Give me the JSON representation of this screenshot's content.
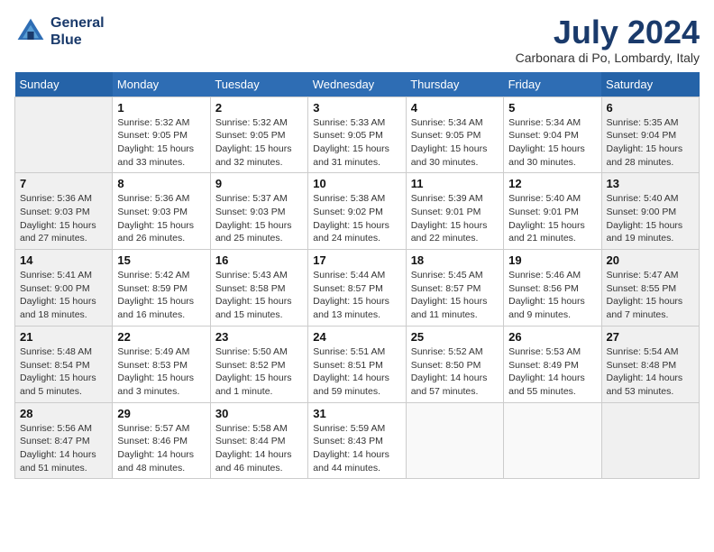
{
  "header": {
    "logo_line1": "General",
    "logo_line2": "Blue",
    "month_title": "July 2024",
    "location": "Carbonara di Po, Lombardy, Italy"
  },
  "days_of_week": [
    "Sunday",
    "Monday",
    "Tuesday",
    "Wednesday",
    "Thursday",
    "Friday",
    "Saturday"
  ],
  "weeks": [
    [
      {
        "day": "",
        "info": ""
      },
      {
        "day": "1",
        "info": "Sunrise: 5:32 AM\nSunset: 9:05 PM\nDaylight: 15 hours\nand 33 minutes."
      },
      {
        "day": "2",
        "info": "Sunrise: 5:32 AM\nSunset: 9:05 PM\nDaylight: 15 hours\nand 32 minutes."
      },
      {
        "day": "3",
        "info": "Sunrise: 5:33 AM\nSunset: 9:05 PM\nDaylight: 15 hours\nand 31 minutes."
      },
      {
        "day": "4",
        "info": "Sunrise: 5:34 AM\nSunset: 9:05 PM\nDaylight: 15 hours\nand 30 minutes."
      },
      {
        "day": "5",
        "info": "Sunrise: 5:34 AM\nSunset: 9:04 PM\nDaylight: 15 hours\nand 30 minutes."
      },
      {
        "day": "6",
        "info": "Sunrise: 5:35 AM\nSunset: 9:04 PM\nDaylight: 15 hours\nand 28 minutes."
      }
    ],
    [
      {
        "day": "7",
        "info": "Sunrise: 5:36 AM\nSunset: 9:03 PM\nDaylight: 15 hours\nand 27 minutes."
      },
      {
        "day": "8",
        "info": "Sunrise: 5:36 AM\nSunset: 9:03 PM\nDaylight: 15 hours\nand 26 minutes."
      },
      {
        "day": "9",
        "info": "Sunrise: 5:37 AM\nSunset: 9:03 PM\nDaylight: 15 hours\nand 25 minutes."
      },
      {
        "day": "10",
        "info": "Sunrise: 5:38 AM\nSunset: 9:02 PM\nDaylight: 15 hours\nand 24 minutes."
      },
      {
        "day": "11",
        "info": "Sunrise: 5:39 AM\nSunset: 9:01 PM\nDaylight: 15 hours\nand 22 minutes."
      },
      {
        "day": "12",
        "info": "Sunrise: 5:40 AM\nSunset: 9:01 PM\nDaylight: 15 hours\nand 21 minutes."
      },
      {
        "day": "13",
        "info": "Sunrise: 5:40 AM\nSunset: 9:00 PM\nDaylight: 15 hours\nand 19 minutes."
      }
    ],
    [
      {
        "day": "14",
        "info": "Sunrise: 5:41 AM\nSunset: 9:00 PM\nDaylight: 15 hours\nand 18 minutes."
      },
      {
        "day": "15",
        "info": "Sunrise: 5:42 AM\nSunset: 8:59 PM\nDaylight: 15 hours\nand 16 minutes."
      },
      {
        "day": "16",
        "info": "Sunrise: 5:43 AM\nSunset: 8:58 PM\nDaylight: 15 hours\nand 15 minutes."
      },
      {
        "day": "17",
        "info": "Sunrise: 5:44 AM\nSunset: 8:57 PM\nDaylight: 15 hours\nand 13 minutes."
      },
      {
        "day": "18",
        "info": "Sunrise: 5:45 AM\nSunset: 8:57 PM\nDaylight: 15 hours\nand 11 minutes."
      },
      {
        "day": "19",
        "info": "Sunrise: 5:46 AM\nSunset: 8:56 PM\nDaylight: 15 hours\nand 9 minutes."
      },
      {
        "day": "20",
        "info": "Sunrise: 5:47 AM\nSunset: 8:55 PM\nDaylight: 15 hours\nand 7 minutes."
      }
    ],
    [
      {
        "day": "21",
        "info": "Sunrise: 5:48 AM\nSunset: 8:54 PM\nDaylight: 15 hours\nand 5 minutes."
      },
      {
        "day": "22",
        "info": "Sunrise: 5:49 AM\nSunset: 8:53 PM\nDaylight: 15 hours\nand 3 minutes."
      },
      {
        "day": "23",
        "info": "Sunrise: 5:50 AM\nSunset: 8:52 PM\nDaylight: 15 hours\nand 1 minute."
      },
      {
        "day": "24",
        "info": "Sunrise: 5:51 AM\nSunset: 8:51 PM\nDaylight: 14 hours\nand 59 minutes."
      },
      {
        "day": "25",
        "info": "Sunrise: 5:52 AM\nSunset: 8:50 PM\nDaylight: 14 hours\nand 57 minutes."
      },
      {
        "day": "26",
        "info": "Sunrise: 5:53 AM\nSunset: 8:49 PM\nDaylight: 14 hours\nand 55 minutes."
      },
      {
        "day": "27",
        "info": "Sunrise: 5:54 AM\nSunset: 8:48 PM\nDaylight: 14 hours\nand 53 minutes."
      }
    ],
    [
      {
        "day": "28",
        "info": "Sunrise: 5:56 AM\nSunset: 8:47 PM\nDaylight: 14 hours\nand 51 minutes."
      },
      {
        "day": "29",
        "info": "Sunrise: 5:57 AM\nSunset: 8:46 PM\nDaylight: 14 hours\nand 48 minutes."
      },
      {
        "day": "30",
        "info": "Sunrise: 5:58 AM\nSunset: 8:44 PM\nDaylight: 14 hours\nand 46 minutes."
      },
      {
        "day": "31",
        "info": "Sunrise: 5:59 AM\nSunset: 8:43 PM\nDaylight: 14 hours\nand 44 minutes."
      },
      {
        "day": "",
        "info": ""
      },
      {
        "day": "",
        "info": ""
      },
      {
        "day": "",
        "info": ""
      }
    ]
  ]
}
